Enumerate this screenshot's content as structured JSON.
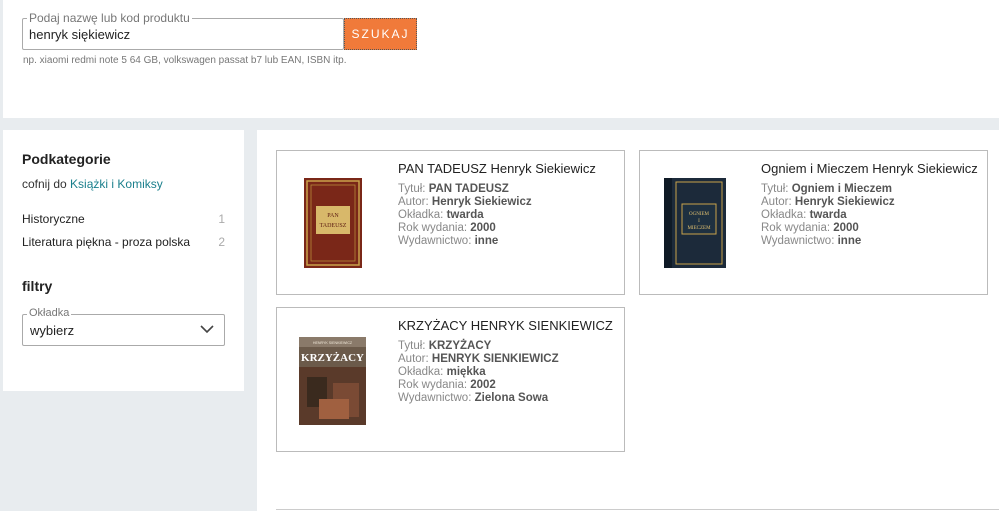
{
  "search": {
    "legend": "Podaj nazwę lub kod produktu",
    "value": "henryk siękiewicz",
    "button": "SZUKAJ",
    "hint": "np. xiaomi redmi note 5 64 GB, volkswagen passat b7 lub EAN, ISBN itp."
  },
  "sidebar": {
    "title": "Podkategorie",
    "back_prefix": "cofnij do",
    "back_link": "Książki i Komiksy",
    "categories": [
      {
        "label": "Historyczne",
        "count": "1"
      },
      {
        "label": "Literatura piękna - proza polska",
        "count": "2"
      }
    ],
    "filters_title": "filtry",
    "filter": {
      "legend": "Okładka",
      "value": "wybierz",
      "icon": "chevron-down-icon"
    }
  },
  "labels": {
    "title": "Tytuł:",
    "author": "Autor:",
    "cover": "Okładka:",
    "year": "Rok wydania:",
    "publisher": "Wydawnictwo:"
  },
  "products": [
    {
      "name": "PAN TADEUSZ Henryk Siekiewicz",
      "title": "PAN TADEUSZ",
      "author": "Henryk Siekiewicz",
      "cover": "twarda",
      "year": "2000",
      "publisher": "inne",
      "cover_text": [
        "PAN",
        "TADEUSZ"
      ]
    },
    {
      "name": "Ogniem i Mieczem Henryk Siekiewicz",
      "title": "Ogniem i Mieczem",
      "author": "Henryk Siekiewicz",
      "cover": "twarda",
      "year": "2000",
      "publisher": "inne",
      "cover_text": [
        "OGNIEM",
        "I",
        "MIECZEM"
      ]
    },
    {
      "name": "KRZYŻACY HENRYK SIENKIEWICZ",
      "title": "KRZYŻACY",
      "author": "HENRYK SIENKIEWICZ",
      "cover": "miękka",
      "year": "2002",
      "publisher": "Zielona Sowa",
      "cover_text": [
        "HENRYK SIENKIEWICZ",
        "KRZYŻACY"
      ]
    }
  ],
  "colors": {
    "accent": "#f07a3a",
    "link": "#1a7f8c"
  }
}
